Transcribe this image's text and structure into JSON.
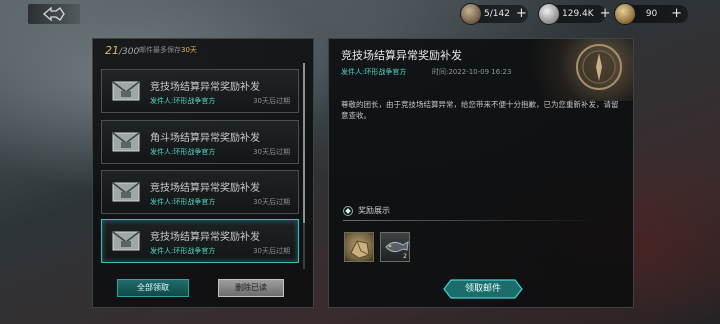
{
  "topbar": {
    "resources": [
      {
        "icon": "stamina-icon",
        "value": "5/142"
      },
      {
        "icon": "silver-coin-icon",
        "value": "129.4K"
      },
      {
        "icon": "gold-coin-icon",
        "value": "90"
      }
    ],
    "plus_label": "+"
  },
  "mailbox": {
    "count_current": "21",
    "count_total": "/300",
    "note_prefix": "邮件最多保存",
    "note_days": "30天",
    "items": [
      {
        "title": "竞技场结算异常奖励补发",
        "sender": "发件人:环形战争官方",
        "expiry": "30天后过期"
      },
      {
        "title": "角斗场结算异常奖励补发",
        "sender": "发件人:环形战争官方",
        "expiry": "30天后过期"
      },
      {
        "title": "竞技场结算异常奖励补发",
        "sender": "发件人:环形战争官方",
        "expiry": "30天后过期"
      },
      {
        "title": "竞技场结算异常奖励补发",
        "sender": "发件人:环形战争官方",
        "expiry": "30天后过期"
      }
    ],
    "claim_all_label": "全部领取",
    "delete_read_label": "删除已读"
  },
  "detail": {
    "title": "竞技场结算异常奖励补发",
    "sender": "发件人:环形战争官方",
    "time": "时间:2022-10-09 16:23",
    "body": "尊敬的团长，由于竞技场结算异常，给您带来不便十分抱歉，已为您重新补发，请留意查收。",
    "rewards_label": "奖励展示",
    "rewards": [
      {
        "icon": "arena-token-icon",
        "count": ""
      },
      {
        "icon": "fish-material-icon",
        "count": "2"
      }
    ],
    "claim_label": "领取邮件"
  },
  "colors": {
    "accent_teal": "#2fbfc0",
    "sender_green": "#4fd6c4",
    "count_gold": "#e0b85a"
  }
}
